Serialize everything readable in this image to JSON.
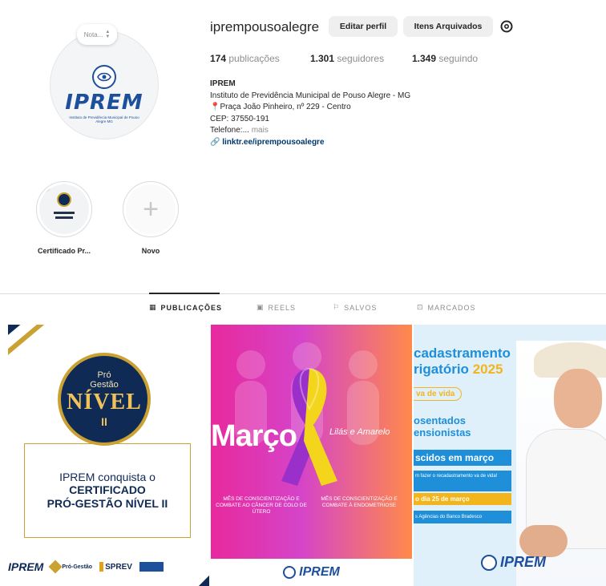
{
  "profile": {
    "username": "iprempousoalegre",
    "note_placeholder": "Nota...",
    "avatar": {
      "logo_text": "IPREM",
      "logo_subtext": "Instituto de Previdência Municipal de Pouso Alegre MG"
    },
    "buttons": {
      "edit_profile": "Editar perfil",
      "archived_items": "Itens Arquivados"
    },
    "stats": {
      "posts_count": "174",
      "posts_label": "publicações",
      "followers_count": "1.301",
      "followers_label": "seguidores",
      "following_count": "1.349",
      "following_label": "seguindo"
    },
    "bio": {
      "name": "IPREM",
      "line1": "Instituto de Previdência Municipal de Pouso Alegre - MG",
      "address": "Praça João Pinheiro, nº 229 - Centro",
      "cep": "CEP: 37550-191",
      "phone_label": "Telefone:...",
      "more": "mais",
      "link": "linktr.ee/iprempousoalegre"
    }
  },
  "highlights": [
    {
      "label": "Certificado Pr..."
    },
    {
      "label": "Novo"
    }
  ],
  "tabs": [
    {
      "label": "PUBLICAÇÕES",
      "icon": "grid-icon",
      "active": true
    },
    {
      "label": "REELS",
      "icon": "reels-icon",
      "active": false
    },
    {
      "label": "SALVOS",
      "icon": "bookmark-icon",
      "active": false
    },
    {
      "label": "MARCADOS",
      "icon": "tagged-icon",
      "active": false
    }
  ],
  "posts": {
    "p1": {
      "badge_small": "Pró",
      "badge_small2": "Gestão",
      "badge_big": "NÍVEL",
      "badge_roman": "II",
      "title": "IPREM conquista o",
      "strong1": "CERTIFICADO",
      "strong2": "PRÓ-GESTÃO NÍVEL II",
      "logo_iprem": "IPREM",
      "logo_pro": "Pró-Gestão",
      "logo_sprev": "SPREV"
    },
    "p2": {
      "marco": "Março",
      "lilas": "Lilás e Amarelo",
      "caption1": "MÊS DE CONSCIENTIZAÇÃO E COMBATE AO CÂNCER DE COLO DE ÚTERO",
      "caption2": "MÊS DE CONSCIENTIZAÇÃO E COMBATE À ENDOMETRIOSE",
      "logo": "IPREM"
    },
    "p3": {
      "h1": "cadastramento",
      "h2": "rigatório",
      "h2_year": "2025",
      "pill": "va de vida",
      "h3_line1": "osentados",
      "h3_line2": "ensionistas",
      "bar_blue": "scidos em março",
      "info": "m fazer o recadastramento va de vida!",
      "bar_yellow": "o dia 25 de março",
      "bar_blue2": "s Agências do Banco Bradesco",
      "logo": "IPREM"
    }
  },
  "colors": {
    "navy": "#0f2a55",
    "gold": "#c9a233",
    "iprem_blue": "#1e4f9c",
    "sky_blue": "#1e8fd8",
    "yellow": "#f2b51b",
    "magenta": "#e8299d",
    "orange": "#ff8a4a"
  }
}
